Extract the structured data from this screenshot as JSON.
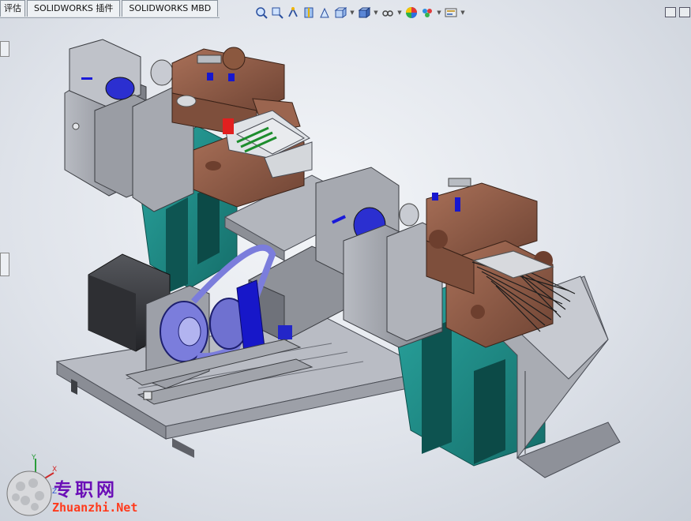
{
  "tabs": {
    "items": [
      {
        "label": "评估"
      },
      {
        "label": "SOLIDWORKS 插件"
      },
      {
        "label": "SOLIDWORKS MBD"
      }
    ]
  },
  "heads_up_toolbar": {
    "icons": [
      "zoom-to-fit-icon",
      "zoom-to-area-icon",
      "previous-view-icon",
      "section-view-icon",
      "dynamic-annotation-icon",
      "view-orientation-icon",
      "display-style-icon",
      "hide-show-items-icon",
      "edit-appearance-icon",
      "apply-scene-icon",
      "view-settings-icon"
    ]
  },
  "triad": {
    "x_label": "X",
    "y_label": "Y",
    "z_label": "Z"
  },
  "watermark": {
    "title": "专职网",
    "url": "Zhuanzhi.Net"
  },
  "colors": {
    "viewport_bg": "#dfe3ea",
    "frame_teal": "#1f8f8a",
    "copper_block": "#8f5d47",
    "steel_gray": "#8c8f96",
    "motor_dark": "#3b3c40",
    "belt_blue": "#7b7ddc",
    "accent_blue": "#1b1bd0",
    "watermark_purple": "#6b0fb7",
    "watermark_red": "#ff3a1c"
  }
}
